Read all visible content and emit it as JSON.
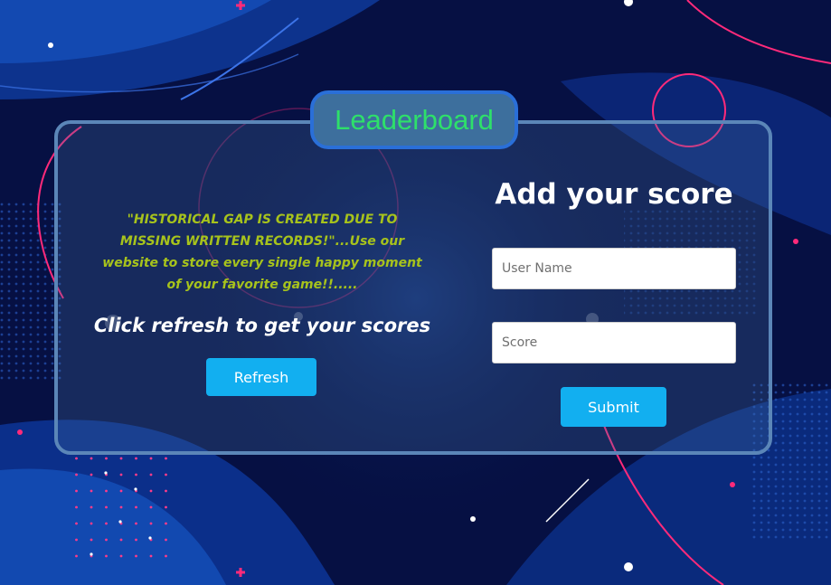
{
  "leaderboard": {
    "title": "Leaderboard",
    "quote": "\"HISTORICAL GAP IS CREATED DUE TO MISSING WRITTEN RECORDS!\"...Use our website to store every single happy moment of your favorite game!!.....",
    "refresh_message": "Click refresh to get your scores",
    "refresh_label": "Refresh"
  },
  "form": {
    "title": "Add your score",
    "name_placeholder": "User Name",
    "score_placeholder": "Score",
    "submit_label": "Submit"
  },
  "colors": {
    "background": "#061043",
    "accent_pink": "#ff2a7a",
    "title_green": "#2ee06a",
    "quote_olive": "#a7c31c",
    "button_blue": "#12aff0"
  }
}
